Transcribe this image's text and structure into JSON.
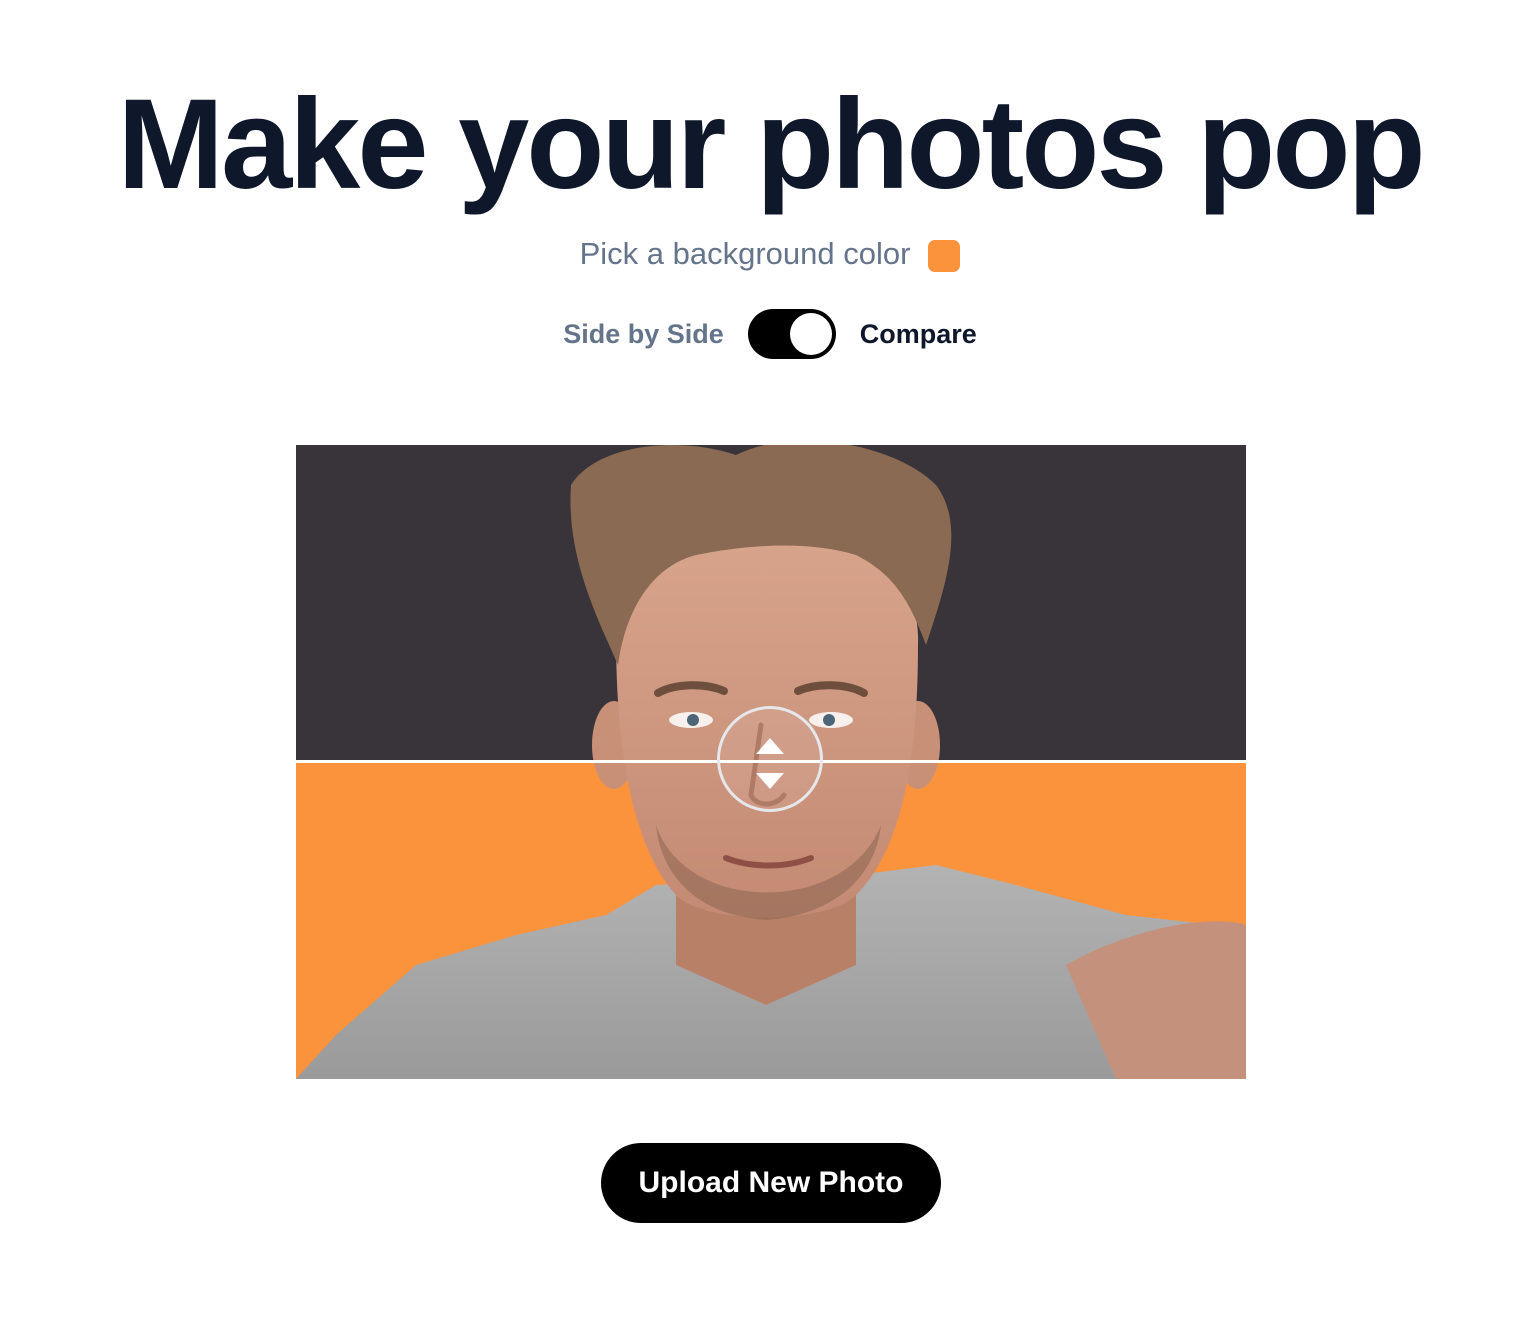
{
  "header": {
    "title": "Make your photos pop"
  },
  "color_picker": {
    "label": "Pick a background color",
    "selected_color": "#fb923c"
  },
  "view_mode": {
    "left_label": "Side by Side",
    "right_label": "Compare",
    "active": "Compare"
  },
  "comparison": {
    "original_background": "#38343a",
    "new_background": "#fb923c",
    "handle_icon": "up-down-arrows-icon"
  },
  "actions": {
    "upload_label": "Upload New Photo"
  }
}
